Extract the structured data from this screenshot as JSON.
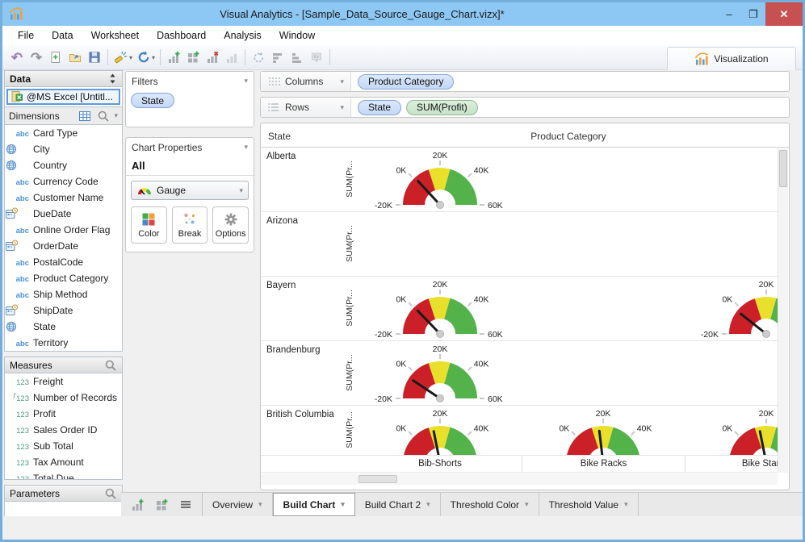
{
  "window": {
    "title": "Visual Analytics - [Sample_Data_Source_Gauge_Chart.vizx]*",
    "controls": {
      "minimize": "–",
      "maximize": "❐",
      "close": "✕"
    }
  },
  "menu": {
    "items": [
      "File",
      "Data",
      "Worksheet",
      "Dashboard",
      "Analysis",
      "Window"
    ]
  },
  "toolbar": {
    "visualization_label": "Visualization",
    "groups": [
      [
        {
          "icon": "undo-icon"
        },
        {
          "icon": "redo-icon"
        },
        {
          "icon": "new-file-icon"
        },
        {
          "icon": "open-file-icon"
        },
        {
          "icon": "save-icon"
        }
      ],
      [
        {
          "icon": "connect-wand-icon",
          "caret": true
        },
        {
          "icon": "refresh-icon",
          "caret": true
        }
      ],
      [
        {
          "icon": "add-worksheet-icon"
        },
        {
          "icon": "add-dashboard-icon"
        },
        {
          "icon": "delete-worksheet-icon"
        },
        {
          "icon": "duplicate-worksheet-icon",
          "disabled": true
        }
      ],
      [
        {
          "icon": "rotate-layout-icon"
        },
        {
          "icon": "sort-bars-icon"
        },
        {
          "icon": "stack-bars-icon"
        },
        {
          "icon": "presentation-icon",
          "disabled": true
        }
      ]
    ]
  },
  "data_panel": {
    "title": "Data",
    "source": "@MS Excel [Untitl...",
    "dimensions": {
      "label": "Dimensions",
      "items": [
        {
          "type": "abc",
          "label": "Card Type"
        },
        {
          "type": "globe",
          "label": "City"
        },
        {
          "type": "globe",
          "label": "Country"
        },
        {
          "type": "abc",
          "label": "Currency Code"
        },
        {
          "type": "abc",
          "label": "Customer Name"
        },
        {
          "type": "date",
          "label": "DueDate"
        },
        {
          "type": "abc",
          "label": "Online Order Flag"
        },
        {
          "type": "date",
          "label": "OrderDate"
        },
        {
          "type": "abc",
          "label": "PostalCode"
        },
        {
          "type": "abc",
          "label": "Product Category"
        },
        {
          "type": "abc",
          "label": "Ship Method"
        },
        {
          "type": "date",
          "label": "ShipDate"
        },
        {
          "type": "globe",
          "label": "State"
        },
        {
          "type": "abc",
          "label": "Territory"
        }
      ]
    },
    "measures": {
      "label": "Measures",
      "items": [
        {
          "type": "num",
          "label": "Freight"
        },
        {
          "type": "fnum",
          "label": "Number of Records"
        },
        {
          "type": "num",
          "label": "Profit"
        },
        {
          "type": "num",
          "label": "Sales Order ID"
        },
        {
          "type": "num",
          "label": "Sub Total"
        },
        {
          "type": "num",
          "label": "Tax Amount"
        },
        {
          "type": "num",
          "label": "Total Due"
        }
      ]
    },
    "parameters": {
      "label": "Parameters"
    }
  },
  "filters_panel": {
    "title": "Filters",
    "pills": [
      {
        "label": "State",
        "kind": "dim"
      }
    ]
  },
  "chart_properties": {
    "title": "Chart Properties",
    "scope": "All",
    "chart_type": "Gauge",
    "buttons": [
      {
        "label": "Color",
        "icon": "color-squares-icon"
      },
      {
        "label": "Break",
        "icon": "break-dots-icon"
      },
      {
        "label": "Options",
        "icon": "gear-icon"
      }
    ]
  },
  "shelves": {
    "columns": {
      "label": "Columns",
      "pills": [
        {
          "label": "Product Category",
          "kind": "dim"
        }
      ]
    },
    "rows": {
      "label": "Rows",
      "pills": [
        {
          "label": "State",
          "kind": "dim"
        },
        {
          "label": "SUM(Profit)",
          "kind": "meas"
        }
      ]
    }
  },
  "tabs": {
    "items": [
      {
        "label": "Overview"
      },
      {
        "label": "Build Chart",
        "active": true
      },
      {
        "label": "Build Chart 2"
      },
      {
        "label": "Threshold Color"
      },
      {
        "label": "Threshold Value"
      }
    ]
  },
  "chart_data": {
    "type": "gauge-grid",
    "corner_label": "State",
    "column_header": "Product Category",
    "row_axis_label": "SUM(Pr...",
    "categories": [
      "Bib-Shorts",
      "Bike Racks",
      "Bike Stands"
    ],
    "gauge": {
      "min": -20000,
      "max": 60000,
      "ticks": [
        {
          "value": -20000,
          "label": "-20K"
        },
        {
          "value": 0,
          "label": "0K"
        },
        {
          "value": 20000,
          "label": "20K"
        },
        {
          "value": 40000,
          "label": "40K"
        },
        {
          "value": 60000,
          "label": "60K"
        }
      ],
      "segments": [
        {
          "from": -20000,
          "to": 12000,
          "color": "#cb2027"
        },
        {
          "from": 12000,
          "to": 27000,
          "color": "#e9e02b"
        },
        {
          "from": 27000,
          "to": 60000,
          "color": "#53b34a"
        }
      ],
      "needle_color": "#1a1a1a",
      "pivot_color": "#cccccc",
      "tick_color": "#c8c8c8"
    },
    "rows": [
      {
        "state": "Alberta",
        "values": [
          1000,
          null,
          null
        ]
      },
      {
        "state": "Arizona",
        "values": [
          null,
          null,
          null
        ]
      },
      {
        "state": "Bayern",
        "values": [
          500,
          null,
          -3000
        ]
      },
      {
        "state": "Brandenburg",
        "values": [
          -5000,
          null,
          null
        ]
      },
      {
        "state": "British Columbia",
        "values": [
          15000,
          17000,
          15000
        ]
      }
    ]
  }
}
